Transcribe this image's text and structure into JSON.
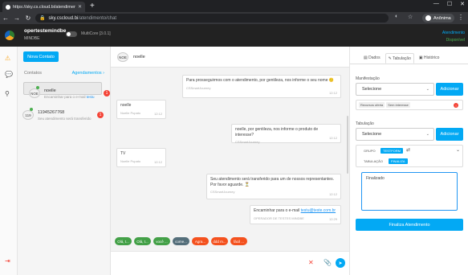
{
  "browser": {
    "tab_title": "https://sky.cs.cloud.bi/atendimento",
    "url_host": "sky.cscloud.bi",
    "url_path": "/atendimento/chat",
    "profile_name": "Anônima"
  },
  "header": {
    "user_name": "opertestemindbe",
    "user_role": "MINDBE",
    "version": "MultiCore [3.0.1]",
    "status_line1": "Atendimento",
    "status_line2": "Disponível"
  },
  "contacts": {
    "new_contact_label": "Nova Contato",
    "title": "Contatos",
    "schedule_label": "Agendamentos",
    "items": [
      {
        "avatar": "NOE",
        "name": "noelle",
        "message": "Encaminhar para o e-mail",
        "message_link": "testu",
        "badge": "1"
      },
      {
        "avatar": "119",
        "name": "11945267768",
        "message": "Seu atendimento será transferido",
        "badge": "1"
      }
    ]
  },
  "chat": {
    "contact_avatar": "NOE",
    "contact_name": "noelle",
    "messages": [
      {
        "side": "right",
        "text": "Para prosseguirmos com o atendimento, por gentileza, nos informe o seu nome 🙂",
        "sender": "CSSmartJourney",
        "time": "12:12"
      },
      {
        "side": "left",
        "text": "noelle",
        "sender": "Noelle Pupato",
        "time": "12:12"
      },
      {
        "side": "right",
        "text": "noelle, por gentileza, nos informe o produto de interesse?",
        "sender": "CSSmartJourney",
        "time": "12:12"
      },
      {
        "side": "left",
        "text": "TV",
        "sender": "Noelle Pupato",
        "time": "12:12"
      },
      {
        "side": "right",
        "text": "Seu atendimento será transferido para um de nossos representantes. Por favor aguarde. ⏳",
        "sender": "CSSmartJourney",
        "time": "12:12"
      },
      {
        "side": "right",
        "text": "Encaminhar para o e-mail",
        "link": "testu@teste.com.br",
        "sender": "OPERADOR DE TESTES MINDBE",
        "time": "12:29"
      }
    ],
    "quick_replies": [
      {
        "label": "Olá, t...",
        "color": "#43a047"
      },
      {
        "label": "Olá, t...",
        "color": "#43a047"
      },
      {
        "label": "você ...",
        "color": "#43a047"
      },
      {
        "label": "come...",
        "color": "#546e7a"
      },
      {
        "label": "Agra...",
        "color": "#f4511e"
      },
      {
        "label": "ddd m...",
        "color": "#f4511e"
      },
      {
        "label": "fácil ...",
        "color": "#f4511e"
      }
    ]
  },
  "panel": {
    "tabs": [
      "Dados",
      "Tabulação",
      "Histórico"
    ],
    "manifest_label": "Manifestação",
    "manifest_value": "Selecione",
    "add_label": "Adicionar",
    "manifest_tags": [
      "Recursos oferta",
      "Sem interesse"
    ],
    "tabulation_label": "Tabulação",
    "tabulation_value": "Selecione",
    "group_label": "GRUPO",
    "group_value": "TESTFORM",
    "tab_label": "TABULAÇÃO",
    "tab_value": "FINALIZA",
    "notes": "Finalizado",
    "finish_label": "Finaliza Atendimento"
  }
}
